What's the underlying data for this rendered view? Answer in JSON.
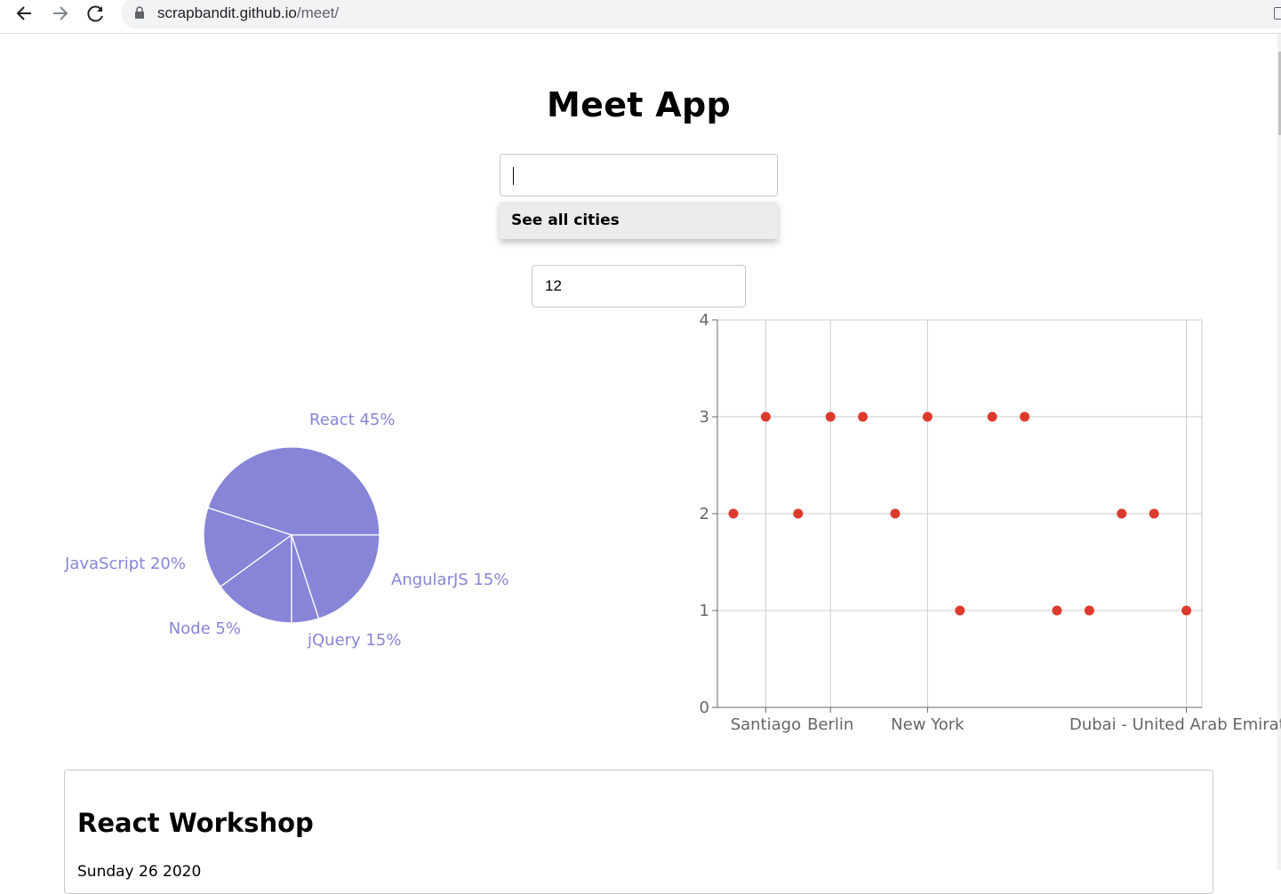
{
  "browser": {
    "url_host": "scrapbandit.github.io",
    "url_path": "/meet/"
  },
  "app": {
    "title": "Meet App",
    "city_search": {
      "value": "",
      "placeholder": ""
    },
    "suggestions": [
      "See all cities"
    ],
    "number_of_events": "12"
  },
  "pie_chart": {
    "chart_data": {
      "type": "pie",
      "slices": [
        {
          "label": "React 45%",
          "name": "React",
          "value": 45
        },
        {
          "label": "AngularJS 15%",
          "name": "AngularJS",
          "value": 15
        },
        {
          "label": "jQuery 15%",
          "name": "jQuery",
          "value": 15
        },
        {
          "label": "Node 5%",
          "name": "Node",
          "value": 5
        },
        {
          "label": "JavaScript 20%",
          "name": "JavaScript",
          "value": 20
        }
      ],
      "color": "#8884d8"
    }
  },
  "chart_data": {
    "type": "scatter",
    "ylim": [
      0,
      4
    ],
    "yticks": [
      0,
      1,
      2,
      3,
      4
    ],
    "xtick_labels": [
      "Santiago",
      "Berlin",
      "New York",
      "Dubai - United Arab Emirates"
    ],
    "x_index_of_ticks": [
      1,
      3,
      6,
      14
    ],
    "point_color": "#dd3a2e",
    "points": [
      {
        "x": 0,
        "y": 2
      },
      {
        "x": 1,
        "y": 3
      },
      {
        "x": 2,
        "y": 2
      },
      {
        "x": 3,
        "y": 3
      },
      {
        "x": 4,
        "y": 3
      },
      {
        "x": 5,
        "y": 2
      },
      {
        "x": 6,
        "y": 3
      },
      {
        "x": 7,
        "y": 1
      },
      {
        "x": 8,
        "y": 3
      },
      {
        "x": 9,
        "y": 3
      },
      {
        "x": 10,
        "y": 1
      },
      {
        "x": 11,
        "y": 1
      },
      {
        "x": 12,
        "y": 2
      },
      {
        "x": 13,
        "y": 2
      },
      {
        "x": 14,
        "y": 1
      }
    ]
  },
  "event": {
    "title": "React Workshop",
    "date": "Sunday 26 2020"
  }
}
